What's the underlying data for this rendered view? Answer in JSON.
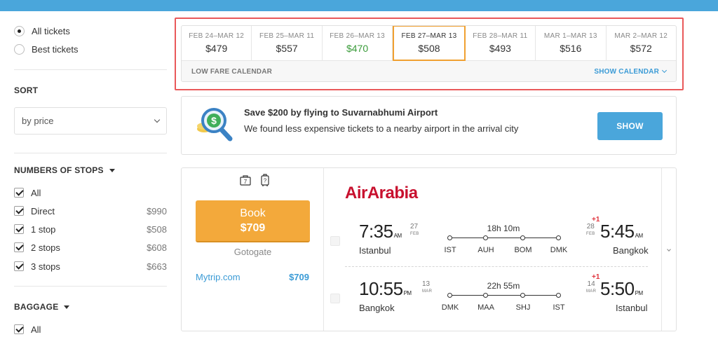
{
  "sidebar": {
    "ticket_filter": [
      {
        "label": "All tickets",
        "selected": true
      },
      {
        "label": "Best tickets",
        "selected": false
      }
    ],
    "sort": {
      "title": "SORT",
      "value": "by price"
    },
    "stops": {
      "title": "NUMBERS OF STOPS",
      "items": [
        {
          "label": "All",
          "price": "",
          "checked": true
        },
        {
          "label": "Direct",
          "price": "$990",
          "checked": true
        },
        {
          "label": "1 stop",
          "price": "$508",
          "checked": true
        },
        {
          "label": "2 stops",
          "price": "$608",
          "checked": true
        },
        {
          "label": "3 stops",
          "price": "$663",
          "checked": true
        }
      ]
    },
    "baggage": {
      "title": "BAGGAGE",
      "items": [
        {
          "label": "All",
          "checked": true
        }
      ]
    }
  },
  "calendar": {
    "dates": [
      {
        "range": "FEB 24–MAR 12",
        "fare": "$479",
        "state": "normal"
      },
      {
        "range": "FEB 25–MAR 11",
        "fare": "$557",
        "state": "normal"
      },
      {
        "range": "FEB 26–MAR 13",
        "fare": "$470",
        "state": "cheapest"
      },
      {
        "range": "FEB 27–MAR 13",
        "fare": "$508",
        "state": "selected"
      },
      {
        "range": "FEB 28–MAR 11",
        "fare": "$493",
        "state": "normal"
      },
      {
        "range": "MAR 1–MAR 13",
        "fare": "$516",
        "state": "normal"
      },
      {
        "range": "MAR 2–MAR 12",
        "fare": "$572",
        "state": "normal"
      }
    ],
    "footer_label": "LOW FARE CALENDAR",
    "show_label": "SHOW CALENDAR",
    "colors": {
      "highlight": "#e9595a",
      "selected": "#f0a030",
      "cheapest": "#3a9b3a",
      "link": "#3b9bd6"
    }
  },
  "promo": {
    "icon": "dollar-magnifier-icon",
    "title": "Save $200 by flying to Suvarnabhumi Airport",
    "subtitle": "We found less expensive tickets to a nearby airport in the arrival city",
    "button_label": "SHOW"
  },
  "ticket": {
    "baggage_icons": [
      {
        "icon": "carry-on-bag-icon",
        "label": "7"
      },
      {
        "icon": "checked-luggage-icon",
        "label": "?"
      }
    ],
    "book": {
      "label": "Book",
      "price": "$709",
      "agency": "Gotogate"
    },
    "alternative": {
      "agency": "Mytrip.com",
      "price": "$709"
    },
    "airline": "AirArabia",
    "segments": [
      {
        "dep_time": "7:35",
        "dep_ampm": "AM",
        "dep_day": "27",
        "dep_month": "FEB",
        "dep_city": "Istanbul",
        "duration": "18h 10m",
        "stops": [
          "IST",
          "AUH",
          "BOM",
          "DMK"
        ],
        "plus_day": "+1",
        "arr_day": "28",
        "arr_month": "FEB",
        "arr_time": "5:45",
        "arr_ampm": "AM",
        "arr_city": "Bangkok"
      },
      {
        "dep_time": "10:55",
        "dep_ampm": "PM",
        "dep_day": "13",
        "dep_month": "MAR",
        "dep_city": "Bangkok",
        "duration": "22h 55m",
        "stops": [
          "DMK",
          "MAA",
          "SHJ",
          "IST"
        ],
        "plus_day": "+1",
        "arr_day": "14",
        "arr_month": "MAR",
        "arr_time": "5:50",
        "arr_ampm": "PM",
        "arr_city": "Istanbul"
      }
    ]
  },
  "colors": {
    "topbar": "#4aa6db",
    "book_button": "#f3a93b",
    "airline_brand": "#c8102e",
    "plus_day": "#e0323c"
  }
}
